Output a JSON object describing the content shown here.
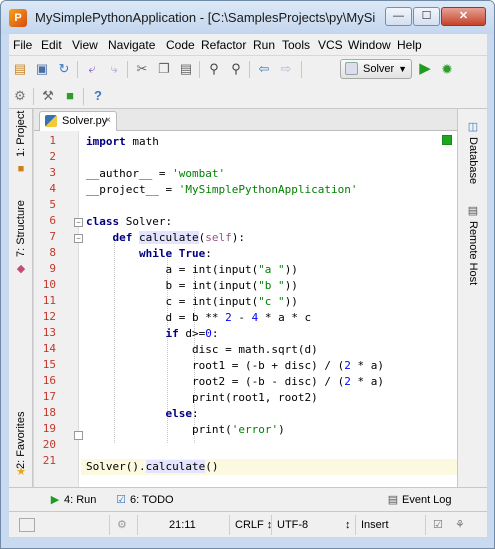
{
  "window": {
    "title": "MySimplePythonApplication - [C:\\SamplesProjects\\py\\MySimpleP...",
    "controls": {
      "minimize": "—",
      "maximize": "☐",
      "close": "✕"
    }
  },
  "menu": [
    "File",
    "Edit",
    "View",
    "Navigate",
    "Code",
    "Refactor",
    "Run",
    "Tools",
    "VCS",
    "Window",
    "Help"
  ],
  "toolbar": {
    "run_config": "Solver"
  },
  "left_tabs": {
    "project": "1: Project",
    "structure": "7: Structure",
    "favorites": "2: Favorites"
  },
  "right_tabs": {
    "database": "Database",
    "remote_host": "Remote Host"
  },
  "editor": {
    "tab_label": "Solver.py",
    "tab_close": "×",
    "line_numbers": [
      "1",
      "2",
      "3",
      "4",
      "5",
      "6",
      "7",
      "8",
      "9",
      "10",
      "11",
      "12",
      "13",
      "14",
      "15",
      "16",
      "17",
      "18",
      "19",
      "20",
      "21"
    ],
    "current_line": 21
  },
  "bottom_tools": {
    "run": "4: Run",
    "todo": "6: TODO",
    "event_log": "Event Log"
  },
  "status": {
    "position": "21:11",
    "line_separator": "CRLF ↕",
    "encoding": "UTF-8",
    "encoding_arrow": "↕",
    "insert_mode": "Insert"
  }
}
